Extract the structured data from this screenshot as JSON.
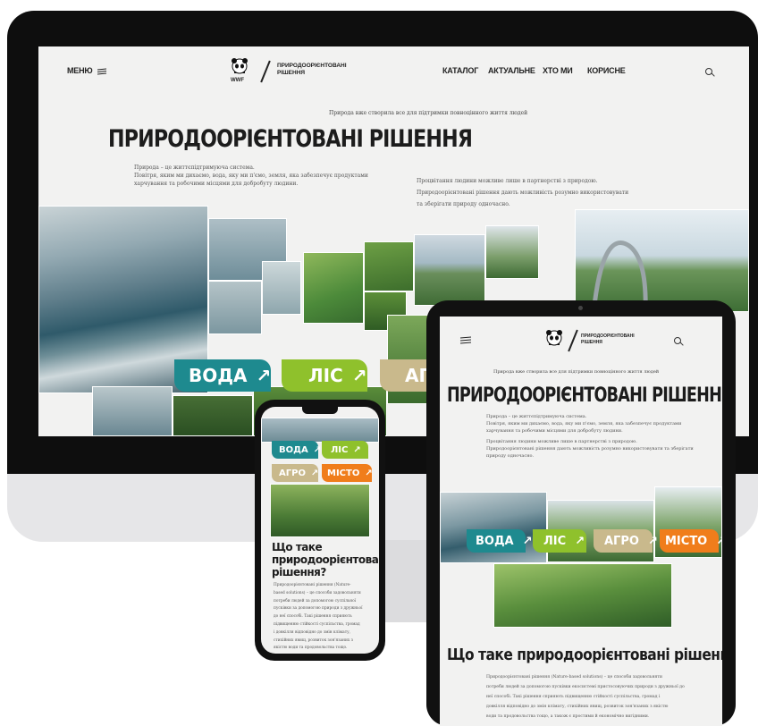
{
  "colors": {
    "water": "#1e8a8f",
    "forest": "#8fc12c",
    "agro": "#c9b98c",
    "city": "#f07d1b",
    "bezel": "#0e0e0e",
    "page_bg": "#f2f2f1"
  },
  "desktop": {
    "menu_label": "МЕНЮ",
    "menu_icon": "menu-lines-icon",
    "logo_wwf": "WWF",
    "logo_title_line1": "ПРИРОДООРІЄНТОВАНІ",
    "logo_title_line2": "РІШЕННЯ",
    "nav": [
      "КАТАЛОГ",
      "АКТУАЛЬНЕ",
      "ХТО МИ",
      "КОРИСНЕ"
    ],
    "search_icon": "search-icon",
    "tagline": "Природа вже створила все для підтримки повноцінного життя людей",
    "heading": "ПРИРОДООРІЄНТОВАНІ РІШЕННЯ",
    "para_left_1": "Природа – це життєпідтримуюча система.",
    "para_left_2": "Повітря, яким ми дихаємо, вода, яку ми п'ємо, земля, яка забезпечує продуктами",
    "para_left_3": "харчування та робочими місцями для добробуту людини.",
    "para_right_1": "Процвітання людини можливе лише в партнерстві з природою.",
    "para_right_2": "Природоорієнтовані рішення дають можливість розумно використовувати",
    "para_right_3": "та зберігати природу одночасно.",
    "categories": [
      {
        "label": "ВОДА",
        "arrow": "↗"
      },
      {
        "label": "ЛІС",
        "arrow": "↗"
      },
      {
        "label": "АГР"
      }
    ]
  },
  "tablet": {
    "logo_title_line1": "ПРИРОДООРІЄНТОВАНІ",
    "logo_title_line2": "РІШЕННЯ",
    "tagline": "Природа вже створила все для підтримки повноцінного життя людей",
    "heading": "ПРИРОДООРІЄНТОВАНІ РІШЕННЯ",
    "para1": "Природа – це життєпідтримуюча система.",
    "para2": "Повітря, яким ми дихаємо, вода, яку ми п'ємо, земля, яка забезпечує продуктами",
    "para3": "харчування та робочими місцями для добробуту людини.",
    "para4": "Процвітання людини можливе лише в партнерстві з природою.",
    "para5": "Природоорієнтовані рішення дають можливість розумно використовувати та зберігати",
    "para6": "природу одночасно.",
    "categories": [
      {
        "label": "ВОДА",
        "arrow": "↗"
      },
      {
        "label": "ЛІС",
        "arrow": "↗"
      },
      {
        "label": "АГРО",
        "arrow": "↗"
      },
      {
        "label": "МІСТО",
        "arrow": "↗"
      }
    ],
    "section_heading": "Що таке природоорієнтовані рішення?",
    "section_lines": [
      "Природоорієнтовані рішення (Nature-based solutions) – це способи задовольняти",
      "потреби людей за допомогою пусківки екосистемі пристосовуючих природи з дружньої до",
      "неї способі. Такі рішення сприяють підвищенню стійкості суспільства, громад і",
      "довкілля відповідно до змін клімату, стихійних явищ, розвиток зон'язаних з якістю",
      "води та продовольства тощо, а також є простими й економічно вигідними."
    ]
  },
  "phone": {
    "categories": [
      {
        "label": "ВОДА",
        "arrow": "↗"
      },
      {
        "label": "ЛІС",
        "arrow": "↗"
      },
      {
        "label": "АГРО",
        "arrow": "↗"
      },
      {
        "label": "МІСТО",
        "arrow": "↗"
      }
    ],
    "section_heading_1": "Що таке",
    "section_heading_2": "природоорієнтовані",
    "section_heading_3": "рішення?",
    "section_lines": [
      "Природоорієнтовані рішення (Nature-",
      "based solutions) – це способи задовольняти",
      "потреби людей за допомогою суспільної",
      "пусківки за допомогою природи з дружньої",
      "до неї способі. Такі рішення сприяють",
      "підвищенню стійкості суспільства, громад",
      "і довкілля відповідно до змін клімату,",
      "стихійних явищ, розвиток зон'язаних з",
      "якістю води та продовольства тощо."
    ]
  }
}
